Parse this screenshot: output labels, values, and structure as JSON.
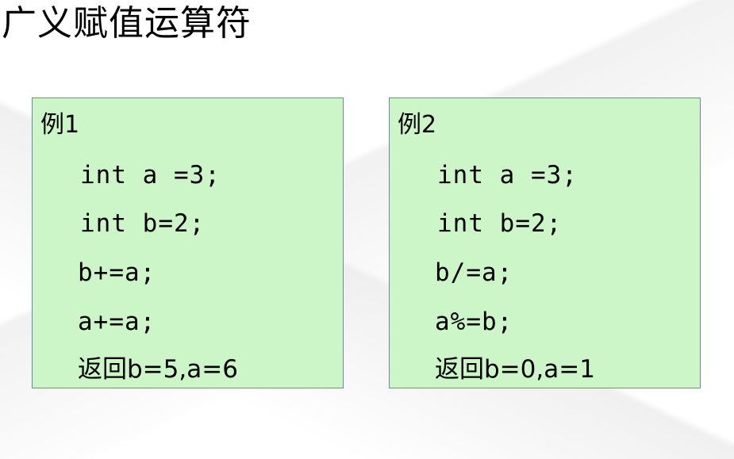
{
  "title": "广义赋值运算符",
  "examples": [
    {
      "heading": "例1",
      "lines": [
        "int a =3;",
        "int b=2;",
        "b+=a;",
        "a+=a;",
        "返回b=5,a=6"
      ]
    },
    {
      "heading": "例2",
      "lines": [
        "int a =3;",
        "int b=2;",
        "b/=a;",
        "a%=b;",
        "返回b=0,a=1"
      ]
    }
  ],
  "colors": {
    "box_fill": "#ccf5c8",
    "box_border": "#6e86a8"
  }
}
